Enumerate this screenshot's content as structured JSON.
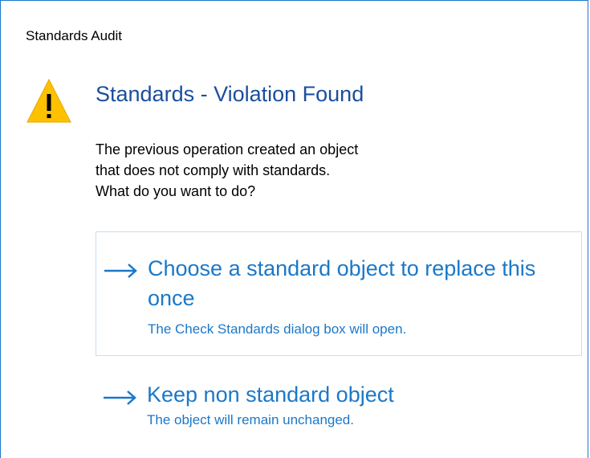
{
  "window": {
    "title": "Standards Audit"
  },
  "dialog": {
    "icon": "warning-icon",
    "heading": "Standards - Violation Found",
    "message_lines": [
      "The previous operation created an object",
      "that does not comply with standards.",
      "What do you want to do?"
    ]
  },
  "options": [
    {
      "icon": "right-arrow-icon",
      "title": "Choose a standard object to replace this once",
      "description": "The Check Standards dialog box will open."
    },
    {
      "icon": "right-arrow-icon",
      "title": "Keep non standard object",
      "description": "The object will remain unchanged."
    }
  ],
  "colors": {
    "heading": "#1a4f9c",
    "link": "#1b78c8",
    "window_border": "#1979ca",
    "hover_border": "#c8ddef",
    "warning_fill": "#ffc000",
    "warning_mark": "#000000"
  }
}
